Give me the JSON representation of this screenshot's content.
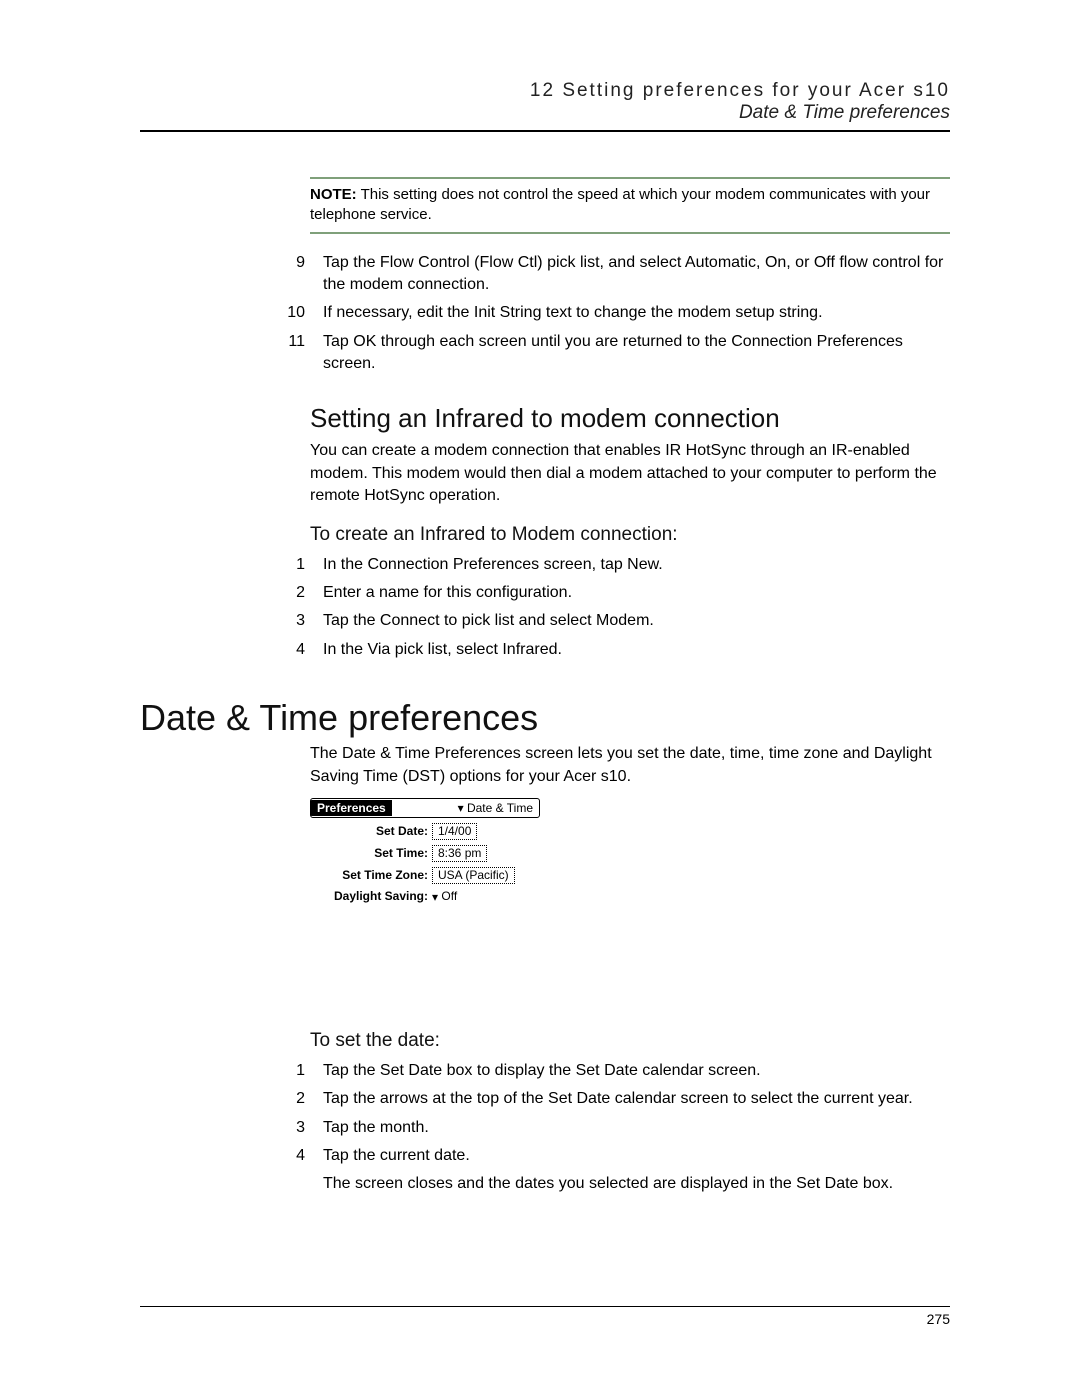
{
  "header": {
    "line1": "12 Setting preferences for your Acer s10",
    "line2": "Date & Time preferences"
  },
  "note": {
    "label": "NOTE:",
    "text": "This setting does not control the speed at which your modem communicates with your telephone service."
  },
  "steps_top": [
    {
      "n": "9",
      "t": "Tap the Flow Control (Flow Ctl) pick list, and select Automatic, On, or Off flow control for the modem connection."
    },
    {
      "n": "10",
      "t": "If necessary, edit the Init String text to change the modem setup string."
    },
    {
      "n": "11",
      "t": "Tap OK through each screen until you are returned to the Connection Preferences screen."
    }
  ],
  "h2_infrared": "Setting an Infrared to modem connection",
  "p_infrared": "You can create a modem connection that enables IR HotSync through an IR-enabled modem. This modem would then dial a modem attached to your computer to perform the remote HotSync operation.",
  "h3_create": "To create an Infrared to Modem connection:",
  "steps_create": [
    {
      "n": "1",
      "t": "In the Connection Preferences screen, tap New."
    },
    {
      "n": "2",
      "t": "Enter a name for this configuration."
    },
    {
      "n": "3",
      "t": "Tap the Connect to pick list and select Modem."
    },
    {
      "n": "4",
      "t": "In the Via pick list, select Infrared."
    }
  ],
  "h1_datetime": "Date & Time preferences",
  "p_datetime": "The Date & Time Preferences screen lets you set the date, time, time zone and Daylight Saving Time (DST) options for your Acer s10.",
  "palm": {
    "title_left": "Preferences",
    "title_right": "Date & Time",
    "rows": [
      {
        "label": "Set Date:",
        "value": "1/4/00"
      },
      {
        "label": "Set Time:",
        "value": "8:36 pm"
      },
      {
        "label": "Set Time Zone:",
        "value": "USA (Pacific)"
      }
    ],
    "dst_label": "Daylight Saving:",
    "dst_value": "Off"
  },
  "h3_setdate": "To set the date:",
  "steps_setdate": [
    {
      "n": "1",
      "t": "Tap the Set Date box to display the Set Date calendar screen."
    },
    {
      "n": "2",
      "t": "Tap the arrows at the top of the Set Date calendar screen to select the current year."
    },
    {
      "n": "3",
      "t": "Tap the month."
    },
    {
      "n": "4",
      "t": "Tap the current date."
    }
  ],
  "close_note": "The screen closes and the dates you selected are displayed in the Set Date box.",
  "page_number": "275"
}
